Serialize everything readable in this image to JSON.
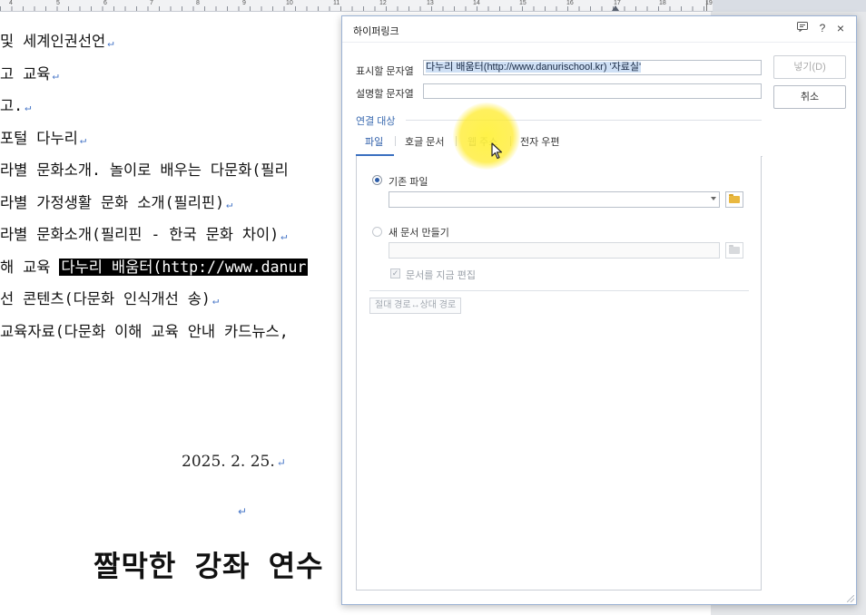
{
  "ruler": {
    "numbers": [
      "4",
      "5",
      "6",
      "7",
      "8",
      "9",
      "10",
      "11",
      "12",
      "13",
      "14",
      "15",
      "16",
      "17",
      "18",
      "19"
    ]
  },
  "document": {
    "lines": [
      {
        "text": "및 세계인권선언",
        "mark": "↵"
      },
      {
        "text": "고 교육",
        "mark": "↵"
      },
      {
        "text": "고.",
        "mark": "↵"
      },
      {
        "text": " 포털 다누리",
        "mark": "↵"
      },
      {
        "text": "라별 문화소개. 놀이로 배우는 다문화(필리",
        "mark": ""
      },
      {
        "text": "라별 가정생활 문화 소개(필리핀)",
        "mark": "↵"
      },
      {
        "text": "라별 문화소개(필리핀 - 한국 문화 차이)",
        "mark": "↵"
      },
      {
        "text": "해 교육 ",
        "selected": "다누리 배움터(http://www.danur",
        "mark": ""
      },
      {
        "text": "선 콘텐츠(다문화 인식개선 송)",
        "mark": "↵"
      },
      {
        "text": "교육자료(다문화 이해 교육 안내 카드뉴스,",
        "mark": ""
      }
    ],
    "date": "2025. 2. 25.",
    "date_mark": "↵",
    "empty_mark": "↵",
    "big_title": "짤막한 강좌 연수"
  },
  "dialog": {
    "title": "하이퍼링크",
    "icons": {
      "help": "?",
      "close": "×"
    },
    "display_label": "표시할 문자열",
    "display_value": "다누리 배움터(http://www.danurischool.kr) '자료실'",
    "desc_label": "설명할 문자열",
    "desc_value": "",
    "insert_button": "넣기(D)",
    "cancel_button": "취소",
    "link_target_label": "연결 대상",
    "tabs": [
      "파일",
      "호글 문서",
      "웹 주소",
      "전자 우편"
    ],
    "active_tab": "파일",
    "existing_file_label": "기존 파일",
    "new_doc_label": "새 문서 만들기",
    "edit_now_label": "문서를 지금 편집",
    "path_toggle_label": "절대 경로↔상대 경로"
  },
  "colors": {
    "accent": "#2c5ca8",
    "selection_bg": "#000000",
    "highlight_yellow": "#ffeb28"
  }
}
